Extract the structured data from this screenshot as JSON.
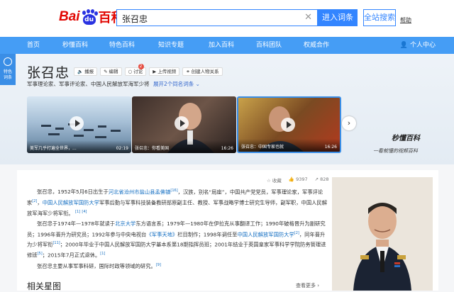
{
  "header": {
    "logo_text_left": "Bai",
    "logo_paw_text": "du",
    "logo_text_right": "百科",
    "search_value": "张召忠",
    "enter_button": "进入词条",
    "all_search_button": "全站搜索",
    "help_link": "帮助"
  },
  "nav": {
    "items": [
      "首页",
      "秒懂百科",
      "特色百科",
      "知识专题",
      "加入百科",
      "百科团队",
      "权威合作"
    ],
    "user_center": "个人中心"
  },
  "side_tag": {
    "line1": "特色",
    "line2": "词条"
  },
  "entry": {
    "title": "张召忠",
    "tools": [
      "播报",
      "编辑",
      "讨论",
      "上传视频",
      "创建人物关系"
    ],
    "discussion_count": "2",
    "subtitle": "军事理论家、军事评论家、中国人民解放军海军少将",
    "expand_link": "展开2个同名词条"
  },
  "videos": [
    {
      "caption": "美军几乎打遍全世界，...",
      "caption2": "和我们交战",
      "duration": "02:19"
    },
    {
      "caption": "张召忠：你看美国",
      "caption2": "军有多少",
      "duration": "16:26"
    },
    {
      "caption": "张召忠：中国专家也就",
      "caption2": "是几年",
      "duration": "16:26"
    }
  ],
  "branding": {
    "name": "秒懂百科",
    "slogan": "一看就懂的视频百科"
  },
  "stats": {
    "favorite": "收藏",
    "likes": "9397",
    "shares": "828"
  },
  "paragraphs": {
    "p1_a": "张召忠，1952年5月6日出生于",
    "p1_link1": "河北省沧州市盐山县孟佛镇",
    "p1_sup1": "[16]",
    "p1_b": "，汉族，别名“局座”，中国共产党党员，军事理论家，军事评论家",
    "p1_sup2": "[2]",
    "p1_c": "，",
    "p1_link2": "中国人民解放军国防大学",
    "p1_d": "军事后勤与军事科技装备教研部原副主任、教授、军事战略学博士研究生导师，副军职，中国人民解放军海军少将军衔。",
    "p1_sup3": "[1]",
    "p1_sup4": "[4]",
    "p2_a": "张召忠于1974年—1978年就读于",
    "p2_link1": "北京大学",
    "p2_b": "东方语言系；1979年—1980年在伊拉克从事翻译工作；1990年破格晋升为副研究员；1996年晋升为研究员；1992年参与中央电视台",
    "p2_link2": "《军事天地》",
    "p2_c": "栏目制作；1998年调任至",
    "p2_link3": "中国人民解放军国防大学",
    "p2_sup1": "[2]",
    "p2_d": "，同年晋升为少将军衔",
    "p2_sup2": "[11]",
    "p2_e": "；2000年毕业于中国人民解放军国防大学基本系第18期指挥员班；2001年结业于英国皇家军事科学学院防务管理进修班",
    "p2_sup3": "[5]",
    "p2_f": "；2015年7月正式退休。",
    "p2_sup4": "[1]",
    "p3_a": "张召忠主要从事军事科研，国际时政等领域的研究。",
    "p3_sup": "[9]"
  },
  "related": {
    "title": "相关星图",
    "more": "查看更多"
  }
}
